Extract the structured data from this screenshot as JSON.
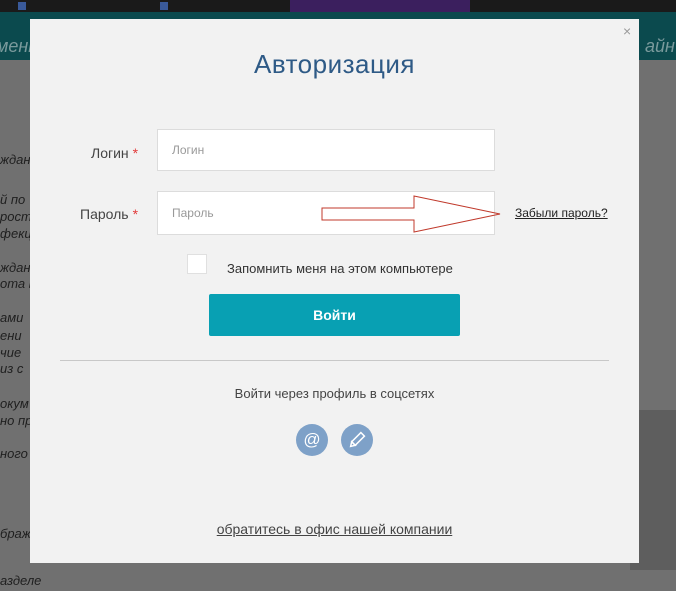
{
  "background": {
    "nav_left": "меню",
    "nav_right": "айн",
    "lines": [
      "ждан",
      "й по",
      "рост",
      "фекц",
      "ждан",
      "ота в",
      "ами",
      "ени",
      "чие",
      "из с",
      "окум",
      "но пр",
      "ного",
      "браж",
      "азделе"
    ]
  },
  "modal": {
    "close_glyph": "×",
    "title": "Авторизация",
    "login_label": "Логин",
    "login_placeholder": "Логин",
    "password_label": "Пароль",
    "password_placeholder": "Пароль",
    "required_mark": "*",
    "forgot_password": "Забыли пароль?",
    "remember_me": "Запомнить меня на этом компьютере",
    "remember_checked": false,
    "submit_label": "Войти",
    "social_title": "Войти через профиль в соцсетях",
    "social_icons": [
      "at-sign-icon",
      "pencil-icon"
    ],
    "office_link": "обратитесь в офис нашей компании"
  },
  "colors": {
    "title": "#2e5a86",
    "submit": "#08a0b3",
    "social": "#7ea1c8",
    "required": "#e23b3b",
    "annotation_arrow": "#c0392b"
  }
}
